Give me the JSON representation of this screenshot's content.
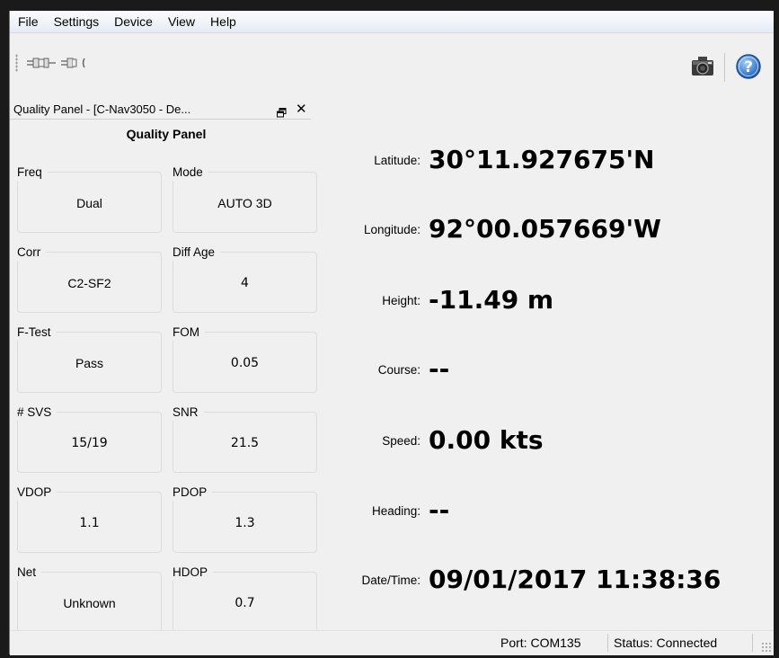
{
  "menu": {
    "items": [
      "File",
      "Settings",
      "Device",
      "View",
      "Help"
    ]
  },
  "toolbar": {
    "connect_icon": "plug-connected-icon",
    "disconnect_icon": "plug-disconnected-icon",
    "camera_icon": "camera-icon",
    "help_icon": "help-icon"
  },
  "panel": {
    "dock_title": "Quality Panel - [C-Nav3050 - De...",
    "float_glyph": "🗗",
    "close_glyph": "✕",
    "header": "Quality Panel",
    "groups": [
      {
        "label": "Freq",
        "value": "Dual"
      },
      {
        "label": "Mode",
        "value": "AUTO 3D"
      },
      {
        "label": "Corr",
        "value": "C2-SF2"
      },
      {
        "label": "Diff Age",
        "value": "4"
      },
      {
        "label": "F-Test",
        "value": "Pass"
      },
      {
        "label": "FOM",
        "value": "0.05"
      },
      {
        "label": "# SVS",
        "value": "15/19"
      },
      {
        "label": "SNR",
        "value": "21.5"
      },
      {
        "label": "VDOP",
        "value": "1.1"
      },
      {
        "label": "PDOP",
        "value": "1.3"
      },
      {
        "label": "Net",
        "value": "Unknown"
      },
      {
        "label": "HDOP",
        "value": "0.7"
      }
    ]
  },
  "readouts": [
    {
      "label": "Latitude:",
      "value": "30°11.927675'N"
    },
    {
      "label": "Longitude:",
      "value": "92°00.057669'W"
    },
    {
      "label": "Height:",
      "value": "-11.49 m"
    },
    {
      "label": "Course:",
      "value": "--"
    },
    {
      "label": "Speed:",
      "value": "0.00 kts"
    },
    {
      "label": "Heading:",
      "value": "--"
    },
    {
      "label": "Date/Time:",
      "value": "09/01/2017 11:38:36"
    }
  ],
  "status": {
    "port": "Port: COM135",
    "state": "Status: Connected"
  },
  "colors": {
    "help_blue": "#2f6fc4",
    "window_bg": "#f0f0f0"
  }
}
